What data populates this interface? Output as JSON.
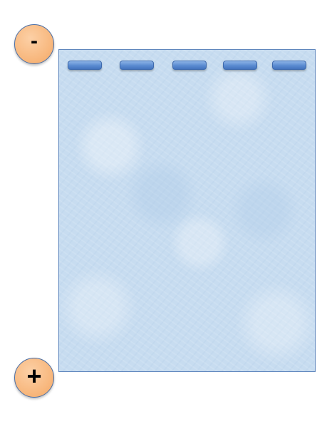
{
  "electrodes": {
    "cathode_symbol": "-",
    "anode_symbol": "+"
  },
  "gel": {
    "well_count": 5
  },
  "colors": {
    "gel_fill": "#c7dcf0",
    "gel_border": "#5f86bd",
    "well_fill": "#5a8bd1",
    "electrode_fill": "#f8b980",
    "electrode_border": "#4a6ea5"
  }
}
